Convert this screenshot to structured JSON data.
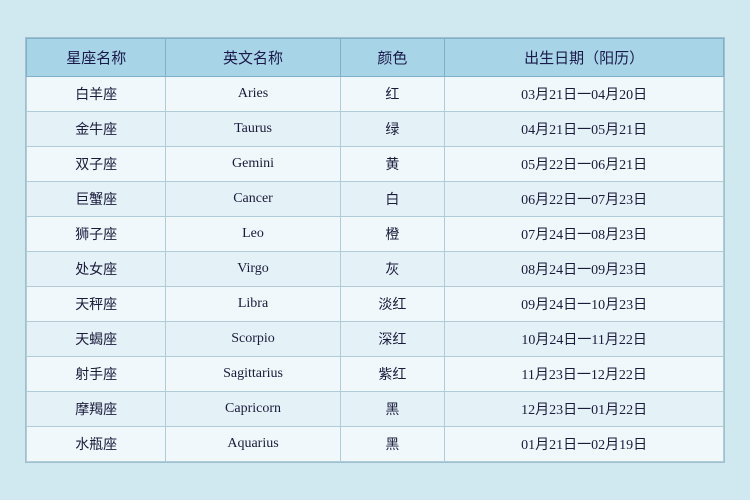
{
  "table": {
    "headers": [
      "星座名称",
      "英文名称",
      "颜色",
      "出生日期（阳历）"
    ],
    "rows": [
      {
        "cn": "白羊座",
        "en": "Aries",
        "color": "红",
        "date": "03月21日一04月20日"
      },
      {
        "cn": "金牛座",
        "en": "Taurus",
        "color": "绿",
        "date": "04月21日一05月21日"
      },
      {
        "cn": "双子座",
        "en": "Gemini",
        "color": "黄",
        "date": "05月22日一06月21日"
      },
      {
        "cn": "巨蟹座",
        "en": "Cancer",
        "color": "白",
        "date": "06月22日一07月23日"
      },
      {
        "cn": "狮子座",
        "en": "Leo",
        "color": "橙",
        "date": "07月24日一08月23日"
      },
      {
        "cn": "处女座",
        "en": "Virgo",
        "color": "灰",
        "date": "08月24日一09月23日"
      },
      {
        "cn": "天秤座",
        "en": "Libra",
        "color": "淡红",
        "date": "09月24日一10月23日"
      },
      {
        "cn": "天蝎座",
        "en": "Scorpio",
        "color": "深红",
        "date": "10月24日一11月22日"
      },
      {
        "cn": "射手座",
        "en": "Sagittarius",
        "color": "紫红",
        "date": "11月23日一12月22日"
      },
      {
        "cn": "摩羯座",
        "en": "Capricorn",
        "color": "黑",
        "date": "12月23日一01月22日"
      },
      {
        "cn": "水瓶座",
        "en": "Aquarius",
        "color": "黑",
        "date": "01月21日一02月19日"
      }
    ]
  }
}
